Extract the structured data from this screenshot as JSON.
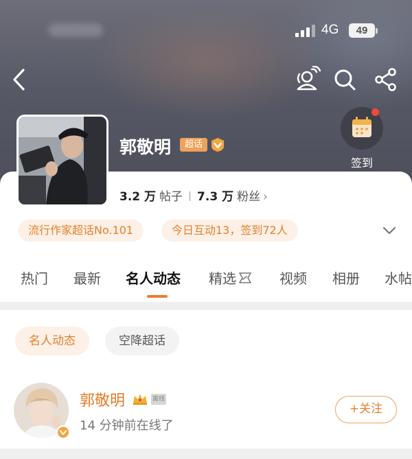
{
  "status_bar": {
    "network": "4G",
    "battery": "49"
  },
  "header": {
    "icons": [
      "back-icon",
      "users-icon",
      "search-icon",
      "share-icon"
    ]
  },
  "topic": {
    "title": "郭敬明",
    "tag": "超话",
    "verified_icon": "v-badge-icon",
    "posts_value": "3.2 万",
    "posts_label": "帖子",
    "fans_value": "7.3 万",
    "fans_label": "粉丝",
    "fans_chevron": "›",
    "rank_pill": "流行作家超话No.101",
    "today_pill": "今日互动13，签到72人",
    "checkin_label": "签到"
  },
  "tabs": [
    {
      "label": "热门"
    },
    {
      "label": "最新"
    },
    {
      "label": "名人动态",
      "active": true
    },
    {
      "label": "精选"
    },
    {
      "label": "视频"
    },
    {
      "label": "相册"
    },
    {
      "label": "水帖"
    }
  ],
  "filter_chips": [
    {
      "label": "名人动态",
      "active": true
    },
    {
      "label": "空降超话",
      "active": false
    }
  ],
  "celebrity": {
    "name": "郭敬明",
    "offline_tag": "离线",
    "status": "14 分钟前在线了",
    "follow_label": "+关注"
  },
  "colors": {
    "accent": "#e3812d",
    "pill_bg": "#fdf0e6",
    "checkin_dot": "#f04a3a"
  }
}
